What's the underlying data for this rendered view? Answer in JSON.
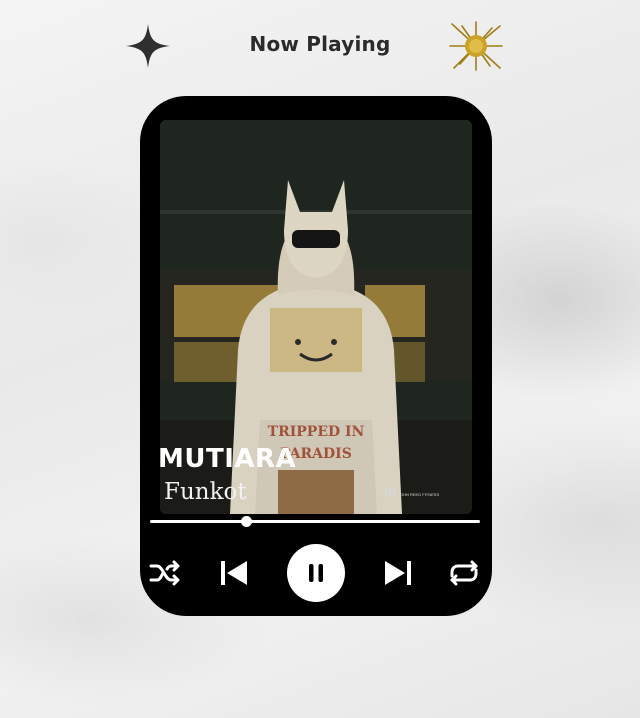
{
  "header": {
    "title": "Now Playing",
    "left_icon": "sparkle-icon",
    "right_icon": "sunburst-icon"
  },
  "player": {
    "cover": {
      "description_icon": "album-cover",
      "logo_text": "JR",
      "logo_subtext": "JOHN REED FITNESS",
      "hoodie_text_1": "TRIPPED IN",
      "hoodie_text_2": "PARADIS"
    },
    "track": {
      "title": "MUTIARA",
      "artist": "Funkot"
    },
    "progress": 0.29,
    "controls": {
      "shuffle": "shuffle-icon",
      "previous": "previous-icon",
      "pause": "pause-icon",
      "next": "next-icon",
      "repeat": "repeat-icon"
    }
  },
  "colors": {
    "player_bg": "#000000",
    "accent_gold": "#c9a227",
    "title_text": "#2b2b2b"
  }
}
